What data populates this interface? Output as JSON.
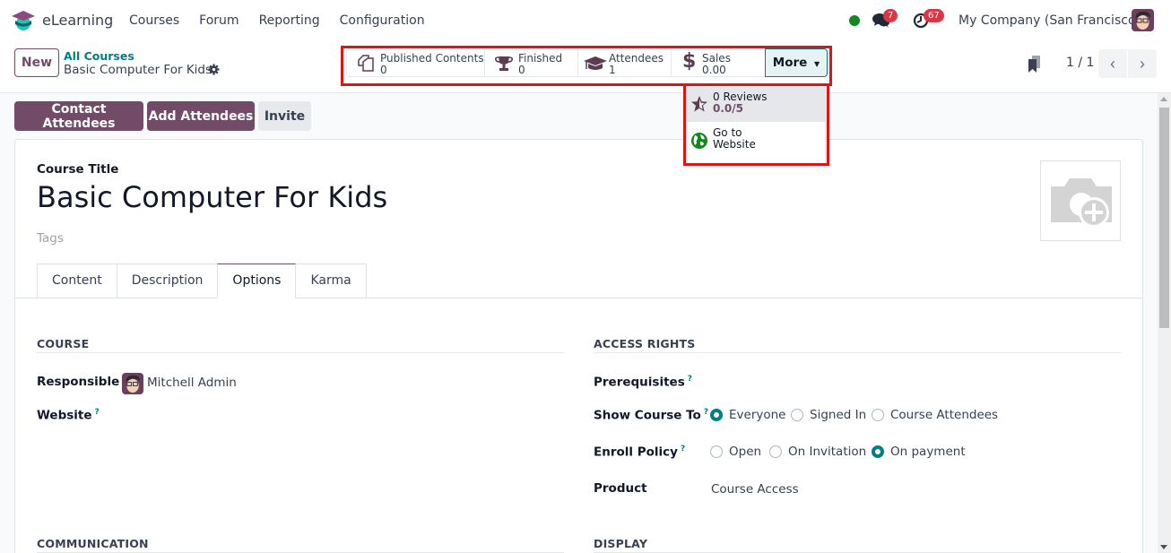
{
  "navbar": {
    "app_name": "eLearning",
    "menu": [
      "Courses",
      "Forum",
      "Reporting",
      "Configuration"
    ],
    "chat_count": "7",
    "activity_count": "67",
    "company": "My Company (San Francisco)",
    "status_color": "#12891f"
  },
  "control_panel": {
    "new_label": "New",
    "breadcrumb_parent": "All Courses",
    "breadcrumb_current": "Basic Computer For Kids",
    "pager": "1 / 1",
    "stats": [
      {
        "icon": "copy-icon",
        "label": "Published Contents",
        "value": "0"
      },
      {
        "icon": "trophy-icon",
        "label": "Finished",
        "value": "0"
      },
      {
        "icon": "graduation-cap-icon",
        "label": "Attendees",
        "value": "1"
      },
      {
        "icon": "dollar-icon",
        "label": "Sales",
        "value": "0.00"
      }
    ],
    "more_label": "More",
    "more_menu": [
      {
        "icon": "star-icon",
        "line1": "0 Reviews",
        "line2": "0.0/5"
      },
      {
        "icon": "globe-icon",
        "line1": "Go to",
        "line2": "Website"
      }
    ]
  },
  "actions": {
    "contact": "Contact Attendees",
    "add": "Add Attendees",
    "invite": "Invite"
  },
  "form": {
    "title_label": "Course Title",
    "title": "Basic Computer For Kids",
    "tags_placeholder": "Tags",
    "tabs": [
      "Content",
      "Description",
      "Options",
      "Karma"
    ],
    "active_tab": "Options",
    "course_group": {
      "title": "COURSE",
      "responsible_label": "Responsible",
      "responsible_value": "Mitchell Admin",
      "website_label": "Website",
      "website_help": "?"
    },
    "access_group": {
      "title": "ACCESS RIGHTS",
      "prerequisites_label": "Prerequisites",
      "show_label": "Show Course To",
      "show_options": [
        "Everyone",
        "Signed In",
        "Course Attendees"
      ],
      "show_selected": "Everyone",
      "enroll_label": "Enroll Policy",
      "enroll_options": [
        "Open",
        "On Invitation",
        "On payment"
      ],
      "enroll_selected": "On payment",
      "product_label": "Product",
      "product_value": "Course Access",
      "help": "?"
    },
    "communication_title": "COMMUNICATION",
    "display_title": "DISPLAY"
  },
  "colors": {
    "brand": "#714b67",
    "accent": "#017e84",
    "highlight_box": "#e11414"
  }
}
